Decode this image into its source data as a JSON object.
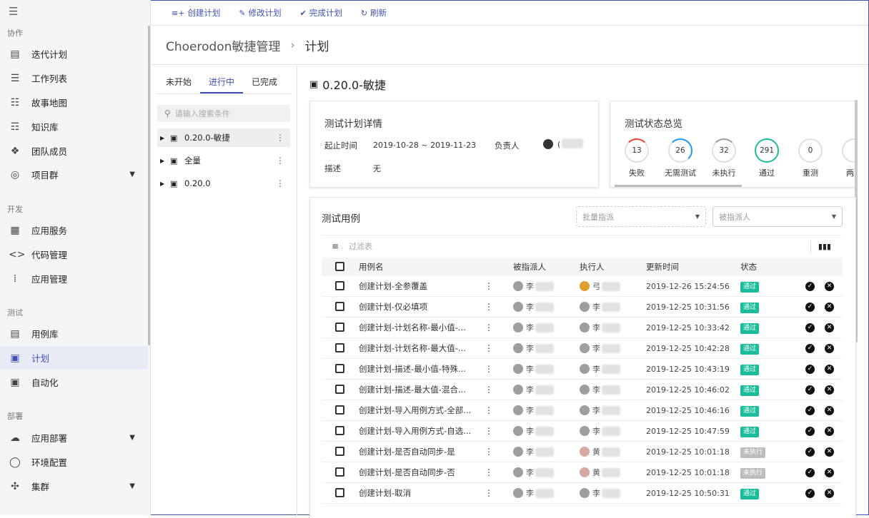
{
  "nav": {
    "sections": [
      {
        "label": "协作",
        "items": [
          {
            "label": "迭代计划",
            "icon": "clipboard-icon"
          },
          {
            "label": "工作列表",
            "icon": "list-icon"
          },
          {
            "label": "故事地图",
            "icon": "map-icon"
          },
          {
            "label": "知识库",
            "icon": "book-icon"
          },
          {
            "label": "团队成员",
            "icon": "member-icon"
          },
          {
            "label": "项目群",
            "icon": "program-icon"
          }
        ]
      },
      {
        "label": "开发",
        "items": [
          {
            "label": "应用服务",
            "icon": "apps-icon"
          },
          {
            "label": "代码管理",
            "icon": "code-icon"
          },
          {
            "label": "应用管理",
            "icon": "grid-icon"
          }
        ]
      },
      {
        "label": "测试",
        "items": [
          {
            "label": "用例库",
            "icon": "document-icon"
          },
          {
            "label": "计划",
            "icon": "calendar-icon"
          },
          {
            "label": "自动化",
            "icon": "automation-icon"
          }
        ]
      },
      {
        "label": "部署",
        "items": [
          {
            "label": "应用部署",
            "icon": "cloud-icon"
          },
          {
            "label": "环境配置",
            "icon": "env-icon"
          },
          {
            "label": "集群",
            "icon": "cluster-icon"
          }
        ]
      }
    ]
  },
  "toolbar": {
    "create": "创建计划",
    "edit": "修改计划",
    "complete": "完成计划",
    "refresh": "刷新"
  },
  "breadcrumb": {
    "root": "Choerodon敏捷管理",
    "sep": "›",
    "current": "计划"
  },
  "tree": {
    "tabs": [
      "未开始",
      "进行中",
      "已完成"
    ],
    "search_placeholder": "请输入搜索条件",
    "nodes": [
      "0.20.0-敏捷",
      "全量",
      "0.20.0"
    ]
  },
  "plan": {
    "title": "0.20.0-敏捷"
  },
  "detail": {
    "title": "测试计划详情",
    "period_label": "起止时间",
    "period_value": "2019-10-28 ~ 2019-11-23",
    "owner_label": "负责人",
    "owner_value": "(",
    "desc_label": "描述",
    "desc_value": "无"
  },
  "status_overview": {
    "title": "测试状态总览",
    "items": [
      {
        "label": "失败",
        "count": "13",
        "color": "#f44336"
      },
      {
        "label": "无需测试",
        "count": "26",
        "color": "#2196f3"
      },
      {
        "label": "未执行",
        "count": "32",
        "color": "#9e9e9e"
      },
      {
        "label": "通过",
        "count": "291",
        "color": "#1bbc9b"
      },
      {
        "label": "重测",
        "count": "0",
        "color": "#e0e0e0"
      },
      {
        "label": "两人",
        "count": "",
        "color": "#e0e0e0"
      }
    ]
  },
  "cases": {
    "title": "测试用例",
    "bulk_assign": "批量指派",
    "assignee_placeholder": "被指派人",
    "filter_placeholder": "过滤表",
    "columns": [
      "用例名",
      "被指派人",
      "执行人",
      "更新时间",
      "状态"
    ],
    "rows": [
      {
        "name": "创建计划-全参覆盖",
        "assignee": "李",
        "executor": "弓",
        "exec_face": "y",
        "time": "2019-12-26 15:24:56",
        "status": "通过",
        "status_type": "pass"
      },
      {
        "name": "创建计划-仅必填项",
        "assignee": "李",
        "executor": "李",
        "exec_face": "g",
        "time": "2019-12-25 10:31:56",
        "status": "通过",
        "status_type": "pass"
      },
      {
        "name": "创建计划-计划名称-最小值-...",
        "assignee": "李",
        "executor": "李",
        "exec_face": "g",
        "time": "2019-12-25 10:33:42",
        "status": "通过",
        "status_type": "pass"
      },
      {
        "name": "创建计划-计划名称-最大值-...",
        "assignee": "李",
        "executor": "李",
        "exec_face": "g",
        "time": "2019-12-25 10:42:28",
        "status": "通过",
        "status_type": "pass"
      },
      {
        "name": "创建计划-描述-最小值-特殊...",
        "assignee": "李",
        "executor": "李",
        "exec_face": "g",
        "time": "2019-12-25 10:43:19",
        "status": "通过",
        "status_type": "pass"
      },
      {
        "name": "创建计划-描述-最大值-混合...",
        "assignee": "李",
        "executor": "李",
        "exec_face": "g",
        "time": "2019-12-25 10:46:02",
        "status": "通过",
        "status_type": "pass"
      },
      {
        "name": "创建计划-导入用例方式-全部...",
        "assignee": "李",
        "executor": "李",
        "exec_face": "g",
        "time": "2019-12-25 10:46:16",
        "status": "通过",
        "status_type": "pass"
      },
      {
        "name": "创建计划-导入用例方式-自选...",
        "assignee": "李",
        "executor": "李",
        "exec_face": "g",
        "time": "2019-12-25 10:47:59",
        "status": "通过",
        "status_type": "pass"
      },
      {
        "name": "创建计划-是否自动同步-是",
        "assignee": "李",
        "executor": "黄",
        "exec_face": "p",
        "time": "2019-12-25 10:01:18",
        "status": "未执行",
        "status_type": "none"
      },
      {
        "name": "创建计划-是否自动同步-否",
        "assignee": "李",
        "executor": "黄",
        "exec_face": "p",
        "time": "2019-12-25 10:01:18",
        "status": "未执行",
        "status_type": "none"
      },
      {
        "name": "创建计划-取消",
        "assignee": "李",
        "executor": "李",
        "exec_face": "g",
        "time": "2019-12-25 10:50:31",
        "status": "通过",
        "status_type": "pass"
      }
    ]
  }
}
